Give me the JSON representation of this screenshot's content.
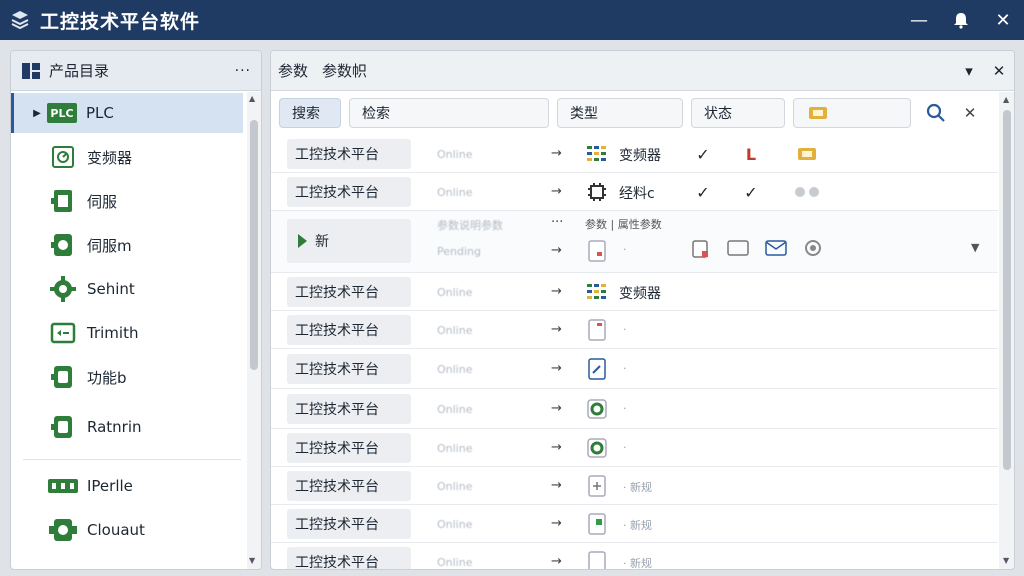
{
  "window": {
    "title": "工控技术平台软件"
  },
  "sidebar": {
    "header": "产品目录",
    "more": "···",
    "items": [
      {
        "label": "PLC",
        "icon": "plc-icon",
        "badge": "PLC"
      },
      {
        "label": "变频器",
        "icon": "inverter-icon"
      },
      {
        "label": "伺服",
        "icon": "servo-icon"
      },
      {
        "label": "伺服m",
        "icon": "servo-motor-icon"
      },
      {
        "label": "Sehint",
        "icon": "gear-icon"
      },
      {
        "label": "Trimith",
        "icon": "display-icon"
      },
      {
        "label": "功能b",
        "icon": "module-icon"
      },
      {
        "label": "Ratnrin",
        "icon": "module-icon"
      },
      {
        "label": "IPerlle",
        "icon": "terminal-block-icon"
      },
      {
        "label": "Clouaut",
        "icon": "cloud-module-icon"
      }
    ]
  },
  "main": {
    "tabs": [
      "参数",
      "参数帜"
    ],
    "filters": [
      {
        "label": "搜索"
      },
      {
        "label": "检索"
      },
      {
        "label": "类型"
      },
      {
        "label": "状态"
      }
    ],
    "rows": [
      {
        "name": "工控技术平台",
        "status": "Online",
        "arrow": "→",
        "icon": "grid-icon",
        "label": "变频器",
        "c1": "✓",
        "c2": "L",
        "c3": "chip"
      },
      {
        "name": "工控技术平台",
        "status": "Online",
        "arrow": "→",
        "icon": "chip-icon",
        "label": "经料c",
        "c1": "✓",
        "c2": "✓",
        "c3": "dots"
      },
      {
        "name": "新",
        "status": "Pending",
        "arrow": "→",
        "icon": "document-icon",
        "label": "",
        "top_status": "参数说明参数",
        "top_arrow": "···",
        "top_label": "参数 | 属性参数",
        "dot": "·",
        "expanded": true
      },
      {
        "name": "工控技术平台",
        "status": "Online",
        "arrow": "→",
        "icon": "grid-icon",
        "label": "变频器"
      },
      {
        "name": "工控技术平台",
        "status": "Online",
        "arrow": "→",
        "icon": "document-icon",
        "label": "",
        "dot": "·"
      },
      {
        "name": "工控技术平台",
        "status": "Online",
        "arrow": "→",
        "icon": "edit-icon",
        "label": "",
        "dot": "·"
      },
      {
        "name": "工控技术平台",
        "status": "Online",
        "arrow": "→",
        "icon": "chip-green-icon",
        "label": "",
        "dot": "·"
      },
      {
        "name": "工控技术平台",
        "status": "Online",
        "arrow": "→",
        "icon": "chip-green-icon",
        "label": "",
        "dot": "·"
      },
      {
        "name": "工控技术平台",
        "status": "Online",
        "arrow": "→",
        "icon": "plus-doc-icon",
        "label": "",
        "dot": "· 新规"
      },
      {
        "name": "工控技术平台",
        "status": "Online",
        "arrow": "→",
        "icon": "green-doc-icon",
        "label": "",
        "dot": "· 新规"
      },
      {
        "name": "工控技术平台",
        "status": "Online",
        "arrow": "→",
        "icon": "document-icon",
        "label": "",
        "dot": "· 新规"
      }
    ]
  }
}
